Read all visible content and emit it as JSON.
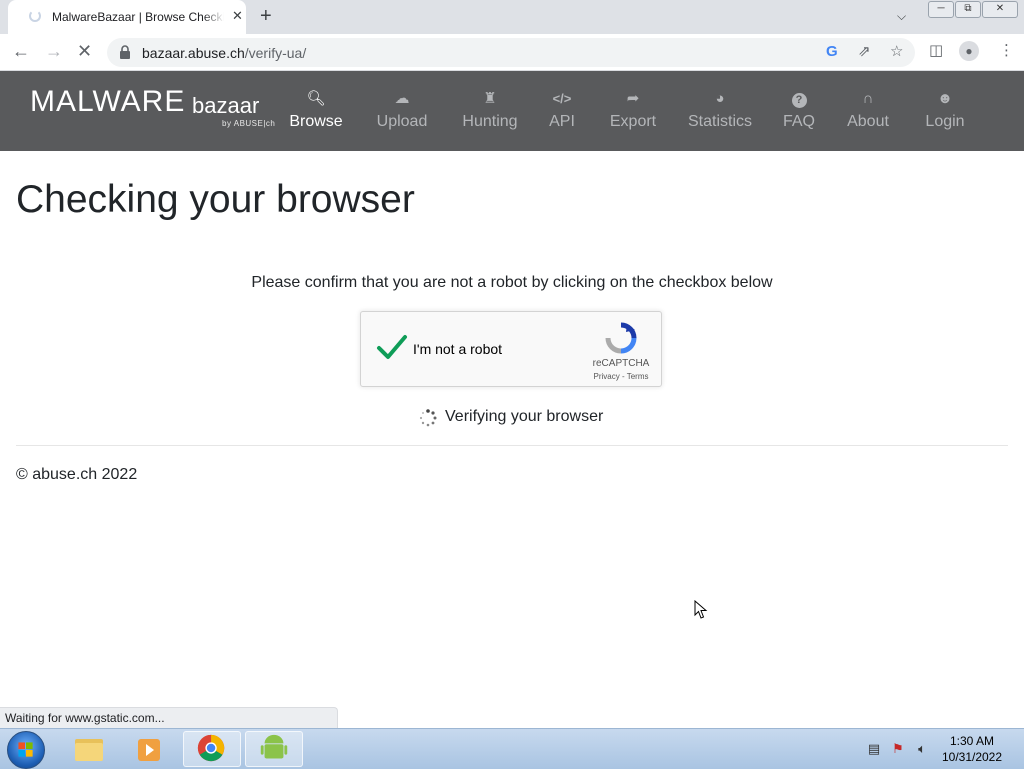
{
  "browser": {
    "tab_title": "MalwareBazaar | Browse Checking your browser",
    "tab_close": "✕",
    "new_tab": "+",
    "url_host": "bazaar.abuse.ch",
    "url_path": "/verify-ua/",
    "status_text": "Waiting for www.gstatic.com..."
  },
  "site": {
    "logo_main": "MALWARE",
    "logo_sub": "bazaar",
    "logo_by": "by ABUSE|ch",
    "nav": [
      {
        "label": "Browse",
        "icon": "search-icon",
        "active": true
      },
      {
        "label": "Upload",
        "icon": "cloud-upload-icon",
        "active": false
      },
      {
        "label": "Hunting",
        "icon": "chess-rook-icon",
        "active": false
      },
      {
        "label": "API",
        "icon": "code-icon",
        "active": false
      },
      {
        "label": "Export",
        "icon": "file-export-icon",
        "active": false
      },
      {
        "label": "Statistics",
        "icon": "pie-chart-icon",
        "active": false
      },
      {
        "label": "FAQ",
        "icon": "question-circle-icon",
        "active": false
      },
      {
        "label": "About",
        "icon": "archway-icon",
        "active": false
      },
      {
        "label": "Login",
        "icon": "user-icon",
        "active": false
      }
    ]
  },
  "main": {
    "title": "Checking your browser",
    "confirm_text": "Please confirm that you are not a robot by clicking on the checkbox below",
    "verify_text": "Verifying your browser",
    "footer": "© abuse.ch 2022"
  },
  "recaptcha": {
    "label": "I'm not a robot",
    "brand": "reCAPTCHA",
    "terms": "Privacy - Terms",
    "checked": true
  },
  "taskbar": {
    "time": "1:30 AM",
    "date": "10/31/2022"
  },
  "colors": {
    "navbar_bg": "#595a5c",
    "nav_active": "#ffffff",
    "nav_inactive": "#b4b6b9",
    "check_green": "#0f9d58",
    "text_dark": "#212529"
  }
}
